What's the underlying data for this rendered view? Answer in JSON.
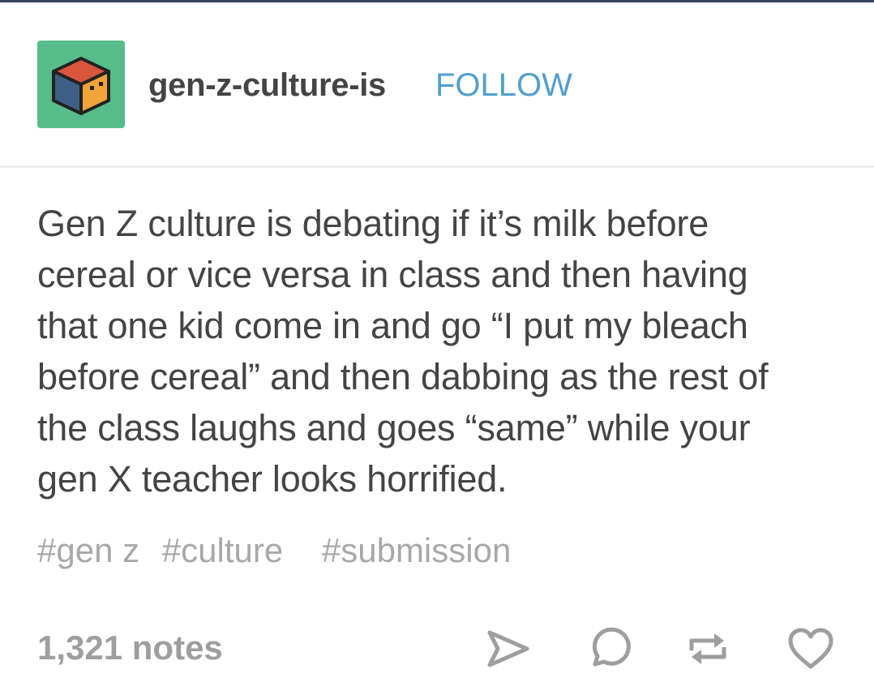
{
  "post": {
    "blog_name": "gen-z-culture-is",
    "follow_label": "FOLLOW",
    "body_lines": [
      "Gen Z culture is debating if it’s milk before",
      "cereal or vice versa in class and then having",
      "that one kid come in and go “I put my bleach",
      "before cereal” and then dabbing as the rest of",
      "the class laughs and goes “same” while your",
      "gen X teacher looks horrified."
    ],
    "tags": [
      "#gen z",
      "#culture",
      "#submission"
    ],
    "notes": "1,321 notes"
  },
  "actions": {
    "share_icon": "paper-plane-icon",
    "reply_icon": "speech-bubble-icon",
    "reblog_icon": "reblog-arrows-icon",
    "like_icon": "heart-icon"
  },
  "colors": {
    "avatar_bg": "#56bc8a",
    "follow": "#529ecc",
    "text": "#444444",
    "tags": "#a8a8a8",
    "icons": "#9e9e9e"
  }
}
